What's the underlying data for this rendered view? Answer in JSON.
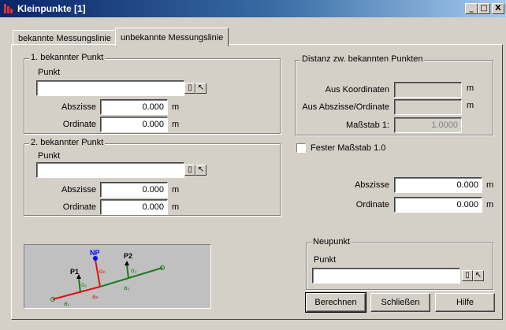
{
  "window": {
    "title": "Kleinpunkte [1]",
    "controls": [
      "_",
      "□",
      "X"
    ]
  },
  "tabs": [
    {
      "label": "bekannte Messungslinie",
      "active": false
    },
    {
      "label": "unbekannte Messungslinie",
      "active": true
    }
  ],
  "group1": {
    "legend": "1. bekannter Punkt",
    "punkt_label": "Punkt",
    "punkt_value": "",
    "abszisse_label": "Abszisse",
    "abszisse_value": "0.000",
    "abszisse_unit": "m",
    "ordinate_label": "Ordinate",
    "ordinate_value": "0.000",
    "ordinate_unit": "m"
  },
  "group2": {
    "legend": "2. bekannter Punkt",
    "punkt_label": "Punkt",
    "punkt_value": "",
    "abszisse_label": "Abszisse",
    "abszisse_value": "0.000",
    "abszisse_unit": "m",
    "ordinate_label": "Ordinate",
    "ordinate_value": "0.000",
    "ordinate_unit": "m"
  },
  "distanz": {
    "legend": "Distanz zw. bekannten Punkten",
    "koordinaten_label": "Aus Koordinaten",
    "koordinaten_value": "",
    "koordinaten_unit": "m",
    "abszisse_ordinate_label": "Aus Abszisse/Ordinate",
    "abszisse_ordinate_value": "",
    "abszisse_ordinate_unit": "m",
    "massstab_label": "Maßstab 1:",
    "massstab_value": "1.0000"
  },
  "fester_massstab": {
    "label": "Fester Maßstab 1.0",
    "checked": false
  },
  "right_fields": {
    "abszisse_label": "Abszisse",
    "abszisse_value": "0.000",
    "abszisse_unit": "m",
    "ordinate_label": "Ordinate",
    "ordinate_value": "0.000",
    "ordinate_unit": "m"
  },
  "neupunkt": {
    "legend": "Neupunkt",
    "punkt_label": "Punkt",
    "punkt_value": ""
  },
  "buttons": {
    "berechnen": "Berechnen",
    "schliessen": "Schließen",
    "hilfe": "Hilfe"
  },
  "diagram_labels": {
    "np": "NP",
    "p1": "P1",
    "p2": "P2",
    "o1": "o₁",
    "on": "oₙ",
    "o2": "o₂",
    "a1": "a₁",
    "an": "aₙ",
    "a2": "a₂"
  },
  "colors": {
    "title_start": "#0a246a",
    "title_end": "#a6caf0",
    "line_green": "#1a7a1a",
    "line_red": "#e01010",
    "np_blue": "#0000ff"
  }
}
